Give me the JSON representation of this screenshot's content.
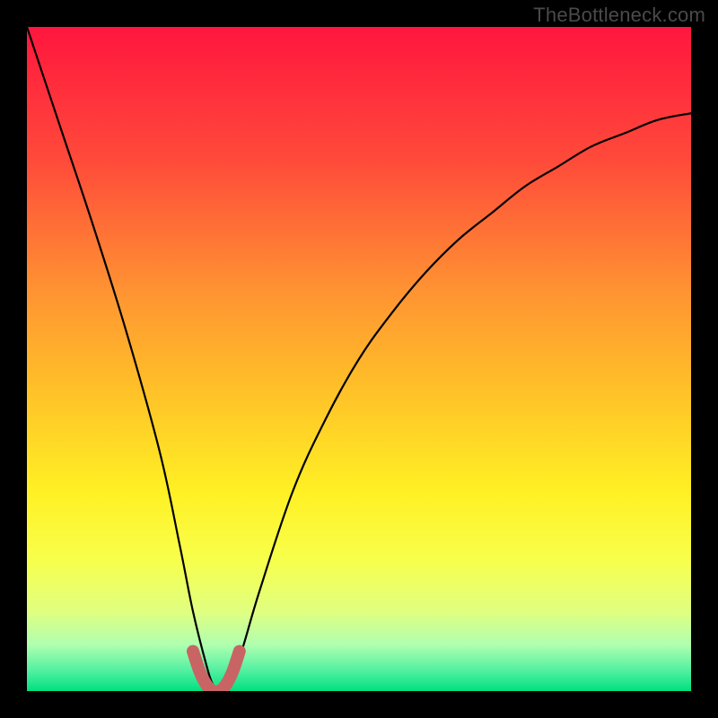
{
  "watermark": "TheBottleneck.com",
  "chart_data": {
    "type": "line",
    "title": "",
    "xlabel": "",
    "ylabel": "",
    "xlim": [
      0,
      100
    ],
    "ylim": [
      0,
      100
    ],
    "grid": false,
    "legend": false,
    "series": [
      {
        "name": "curve",
        "color": "#000000",
        "x": [
          0,
          5,
          10,
          15,
          20,
          23,
          25,
          27,
          28,
          29,
          30,
          32,
          35,
          40,
          45,
          50,
          55,
          60,
          65,
          70,
          75,
          80,
          85,
          90,
          95,
          100
        ],
        "y": [
          100,
          85,
          70,
          54,
          36,
          22,
          12,
          4,
          1,
          0,
          1,
          5,
          15,
          30,
          41,
          50,
          57,
          63,
          68,
          72,
          76,
          79,
          82,
          84,
          86,
          87
        ]
      },
      {
        "name": "highlight",
        "color": "#c86464",
        "x": [
          25,
          26,
          27,
          28,
          29,
          30,
          31,
          32
        ],
        "y": [
          6,
          3,
          1,
          0,
          0,
          1,
          3,
          6
        ]
      }
    ],
    "background_gradient_stops": [
      {
        "offset": 0.0,
        "color": "#ff163e"
      },
      {
        "offset": 0.2,
        "color": "#ff4a3a"
      },
      {
        "offset": 0.4,
        "color": "#ff9432"
      },
      {
        "offset": 0.55,
        "color": "#ffc228"
      },
      {
        "offset": 0.7,
        "color": "#fff024"
      },
      {
        "offset": 0.8,
        "color": "#f8ff4a"
      },
      {
        "offset": 0.88,
        "color": "#e0ff80"
      },
      {
        "offset": 0.93,
        "color": "#b0ffb0"
      },
      {
        "offset": 0.97,
        "color": "#50f0a0"
      },
      {
        "offset": 1.0,
        "color": "#00e080"
      }
    ]
  }
}
